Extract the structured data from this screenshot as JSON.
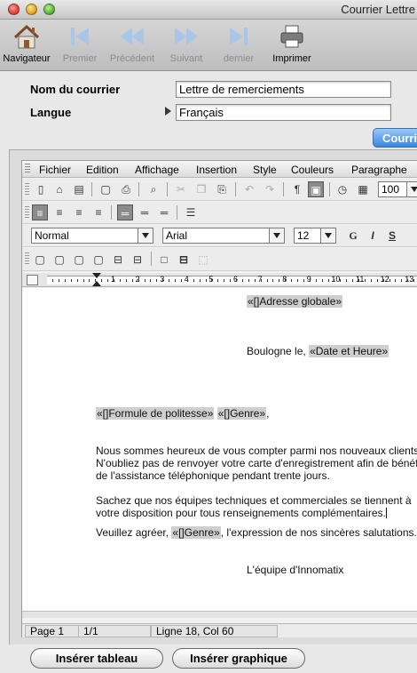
{
  "window": {
    "title": "Courrier Lettre"
  },
  "toolbar": {
    "navigateur": "Navigateur",
    "premier": "Premier",
    "precedent": "Précédent",
    "suivant": "Suivant",
    "dernier": "dernier",
    "imprimer": "Imprimer"
  },
  "form": {
    "nom_label": "Nom du courrier",
    "nom_value": "Lettre de remerciements",
    "langue_label": "Langue",
    "langue_value": "Français",
    "tab_label": "Courrier"
  },
  "menu": {
    "fichier": "Fichier",
    "edition": "Edition",
    "affichage": "Affichage",
    "insertion": "Insertion",
    "style": "Style",
    "couleurs": "Couleurs",
    "paragraphe": "Paragraphe"
  },
  "format": {
    "zoom": "100",
    "style": "Normal",
    "font": "Arial",
    "size": "12",
    "bold": "G",
    "italic": "I",
    "underline": "S",
    "pilcrow": "¶"
  },
  "ruler": {
    "numbers": [
      "1",
      "2",
      "3",
      "4",
      "5",
      "6",
      "7",
      "8",
      "9",
      "10",
      "11",
      "12",
      "13",
      "14"
    ]
  },
  "document": {
    "adresse_field": "«[]Adresse globale»",
    "ville": "Boulogne le, ",
    "date_field": "«Date et Heure»",
    "formule_field": "«[]Formule de politesse»",
    "genre_field": "«[]Genre»",
    "comma": ",",
    "p1_l1": "Nous sommes heureux de vous compter parmi nos nouveaux clients.",
    "p1_l2": "N'oubliez pas de renvoyer votre carte d'enregistrement afin de bénéficier",
    "p1_l3": "de l'assistance téléphonique pendant trente jours.",
    "p2_l1": "Sachez que nos équipes techniques et commerciales se tiennent à",
    "p2_l2": "votre disposition pour tous renseignements complémentaires.",
    "p3_prefix": "Veuillez agréer, ",
    "p3_field": "«[]Genre»",
    "p3_suffix": ", l'expression de nos sincères salutations.",
    "signature": "L'équipe d'Innomatix"
  },
  "status": {
    "page": "Page 1",
    "pages": "1/1",
    "position": "Ligne 18, Col 60"
  },
  "buttons": {
    "inserer_tableau": "Insérer tableau",
    "inserer_graphique": "Insérer graphique"
  }
}
